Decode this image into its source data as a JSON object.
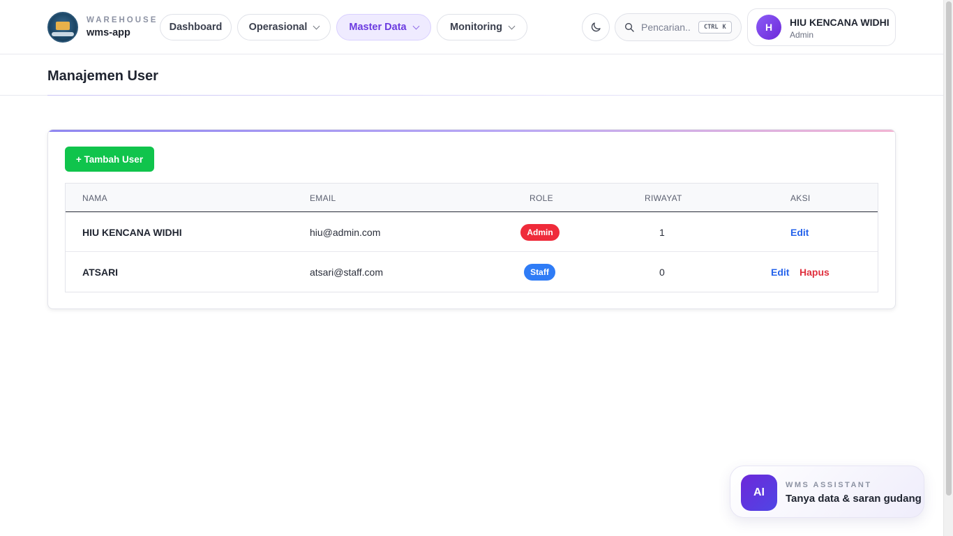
{
  "brand": {
    "small": "WAREHOUSE",
    "name": "wms-app"
  },
  "nav": [
    {
      "label": "Dashboard",
      "icon": ""
    },
    {
      "label": "Operasional",
      "icon": "chevron-down-icon"
    },
    {
      "label": "Master Data",
      "icon": "chevron-down-icon"
    },
    {
      "label": "Monitoring",
      "icon": "chevron-down-icon"
    }
  ],
  "search": {
    "placeholder": "Pencarian...",
    "shortcut_ctrl": "CTRL",
    "shortcut_key": "K"
  },
  "user": {
    "initial": "H",
    "name": "HIU KENCANA WIDHI",
    "role": "Admin"
  },
  "page": {
    "title": "Manajemen User"
  },
  "card": {
    "add_button": "+ Tambah User"
  },
  "table": {
    "headers": [
      "NAMA",
      "EMAIL",
      "ROLE",
      "RIWAYAT",
      "AKSI"
    ],
    "rows": [
      {
        "name": "HIU KENCANA WIDHI",
        "email": "hiu@admin.com",
        "role": "Admin",
        "role_color": "#ef2b3a",
        "riwayat": "1",
        "actions": [
          "Edit"
        ]
      },
      {
        "name": "ATSARI",
        "email": "atsari@staff.com",
        "role": "Staff",
        "role_color": "#2f7cf6",
        "riwayat": "0",
        "actions": [
          "Edit",
          "Hapus"
        ]
      }
    ]
  },
  "assistant": {
    "badge": "AI",
    "label": "WMS ASSISTANT",
    "text": "Tanya data & saran gudang"
  },
  "colors": {
    "accent": "#6b3be0",
    "add_button": "#10c44c",
    "edit": "#2563eb",
    "delete": "#e0303e"
  }
}
